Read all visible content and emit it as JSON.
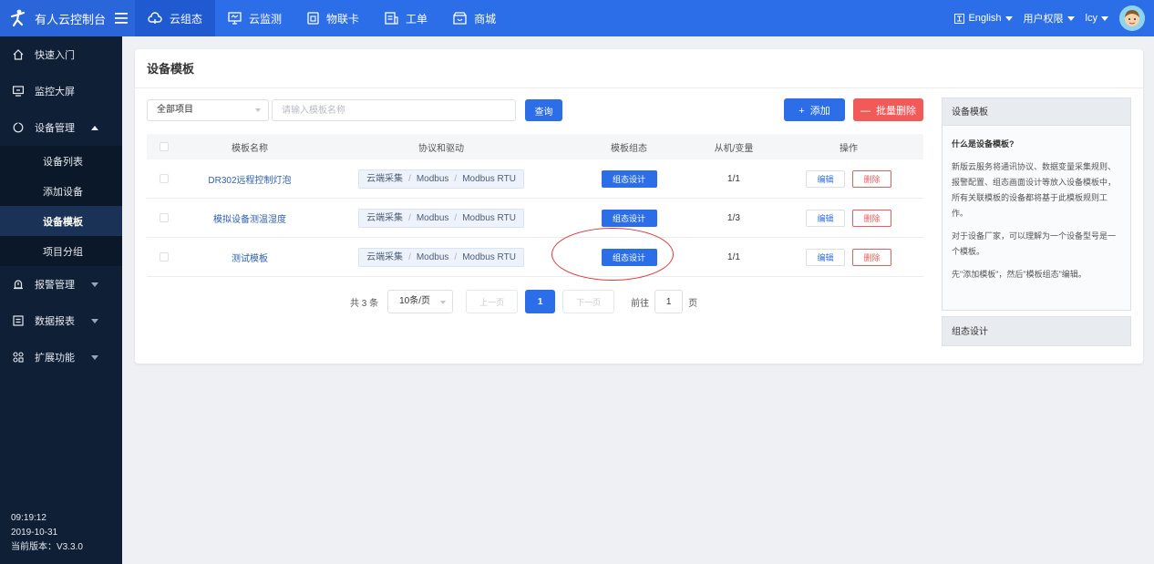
{
  "topbar": {
    "brand_title": "有人云控制台",
    "nav": [
      {
        "label": "云组态",
        "icon": "cloud-icon",
        "active": true
      },
      {
        "label": "云监测",
        "icon": "monitor-icon",
        "active": false
      },
      {
        "label": "物联卡",
        "icon": "sim-card-icon",
        "active": false
      },
      {
        "label": "工单",
        "icon": "work-order-icon",
        "active": false
      },
      {
        "label": "商城",
        "icon": "shop-icon",
        "active": false
      }
    ],
    "language": "English",
    "permissions": "用户权限",
    "user": "lcy"
  },
  "sidebar": {
    "items": [
      {
        "label": "快速入门",
        "icon": "home-icon"
      },
      {
        "label": "监控大屏",
        "icon": "screen-icon"
      },
      {
        "label": "设备管理",
        "icon": "device-icon",
        "expanded": true
      },
      {
        "label": "报警管理",
        "icon": "alarm-icon"
      },
      {
        "label": "数据报表",
        "icon": "report-icon"
      },
      {
        "label": "扩展功能",
        "icon": "extension-icon"
      }
    ],
    "sub_items": [
      {
        "label": "设备列表"
      },
      {
        "label": "添加设备"
      },
      {
        "label": "设备模板",
        "active": true
      },
      {
        "label": "项目分组"
      }
    ],
    "footer": {
      "time": "09:19:12",
      "date": "2019-10-31",
      "version": "当前版本：V3.3.0"
    }
  },
  "main": {
    "title": "设备模板",
    "filter": {
      "project_select": "全部项目",
      "search_placeholder": "请输入模板名称",
      "query_label": "查询"
    },
    "actions": {
      "add_label": "添加",
      "batch_delete_label": "批量删除"
    },
    "table": {
      "headers": [
        "模板名称",
        "协议和驱动",
        "模板组态",
        "从机/变量",
        "操作"
      ],
      "rows": [
        {
          "name": "DR302远程控制灯泡",
          "protocol": [
            "云端采集",
            "Modbus",
            "Modbus RTU"
          ],
          "design": "组态设计",
          "slave": "1/1",
          "edit": "编辑",
          "delete": "删除"
        },
        {
          "name": "模拟设备测温湿度",
          "protocol": [
            "云端采集",
            "Modbus",
            "Modbus RTU"
          ],
          "design": "组态设计",
          "slave": "1/3",
          "edit": "编辑",
          "delete": "删除"
        },
        {
          "name": "测试模板",
          "protocol": [
            "云端采集",
            "Modbus",
            "Modbus RTU"
          ],
          "design": "组态设计",
          "slave": "1/1",
          "edit": "编辑",
          "delete": "删除"
        }
      ]
    },
    "pagination": {
      "total": "共 3 条",
      "page_size": "10条/页",
      "prev": "上一页",
      "current": "1",
      "next": "下一页",
      "goto_label": "前往",
      "goto_value": "1",
      "page_unit": "页"
    }
  },
  "help": {
    "title": "设备模板",
    "question": "什么是设备模板?",
    "paragraphs": [
      "新版云服务将通讯协议、数据变量采集规则、报警配置、组态画面设计等放入设备模板中，所有关联模板的设备都将基于此模板规则工作。",
      "对于设备厂家，可以理解为一个设备型号是一个模板。",
      "先\"添加模板\"，然后\"模板组态\"编辑。"
    ],
    "footer_title": "组态设计"
  },
  "colors": {
    "primary": "#2c6ee8",
    "danger": "#f25a5a",
    "sidebar_bg": "#0f1f36",
    "annotation": "#e03a3a"
  }
}
